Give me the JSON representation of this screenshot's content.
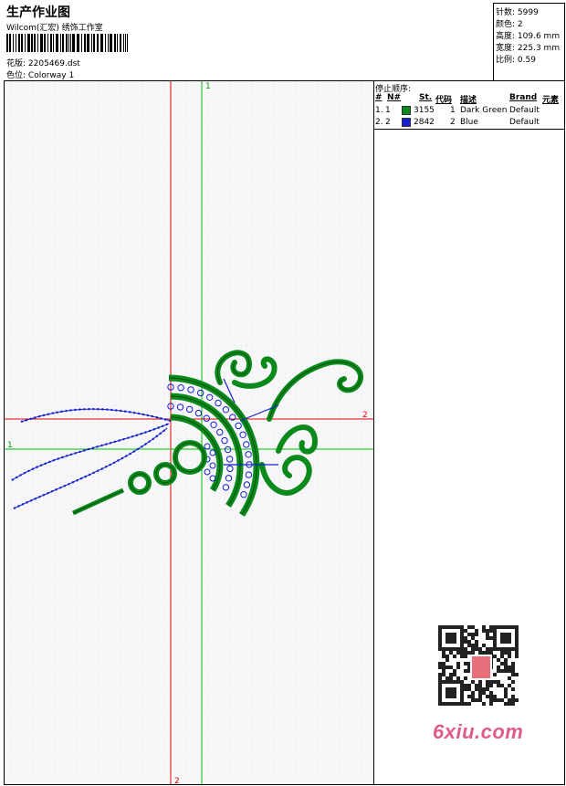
{
  "header": {
    "title": "生产作业图",
    "org": "Wilcom(汇宏) 绣饰工作室",
    "file_label": "花版:",
    "file_value": "2205469.dst",
    "color_label": "色位:",
    "color_value": "Colorway 1"
  },
  "stats": [
    {
      "label": "针数:",
      "value": "5999"
    },
    {
      "label": "颜色:",
      "value": "2"
    },
    {
      "label": "高度:",
      "value": "109.6 mm"
    },
    {
      "label": "宽度:",
      "value": "225.3 mm"
    },
    {
      "label": "比例:",
      "value": "0.59"
    }
  ],
  "guides": {
    "vertical_top": "1",
    "vertical_bottom": "2",
    "horizontal_right": "2",
    "horizontal_left": "1"
  },
  "stop_sequence": {
    "heading": "停止顺序:",
    "columns": [
      "#",
      "N#",
      "St.",
      "代码",
      "描述",
      "Brand",
      "元素"
    ],
    "rows": [
      {
        "index": "1.",
        "n": "1",
        "color": "#0a8a1a",
        "stitches": "3155",
        "code": "1",
        "description": "Dark Green",
        "brand": "Default"
      },
      {
        "index": "2.",
        "n": "2",
        "color": "#1420d0",
        "stitches": "2842",
        "code": "2",
        "description": "Blue",
        "brand": "Default"
      }
    ]
  },
  "colors": {
    "green_fill": "#0a8a1a",
    "blue_stitch": "#1420d0",
    "guide_red": "#e00000",
    "guide_green": "#00c000"
  },
  "watermark": {
    "logo_text": "6xiu.com"
  }
}
